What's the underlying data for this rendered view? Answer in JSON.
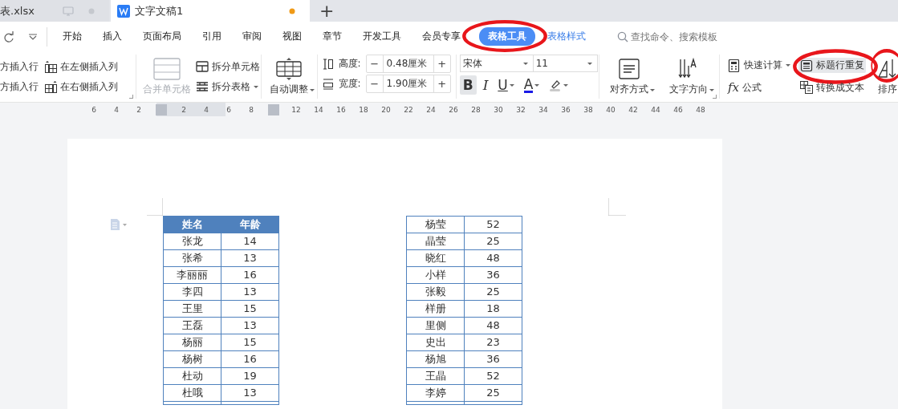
{
  "tabs": [
    {
      "title": "表.xlsx",
      "kind": "sheet",
      "selected": false,
      "modified": false
    },
    {
      "title": "文字文稿1",
      "kind": "doc",
      "selected": true,
      "modified": true
    }
  ],
  "new_tab": "+",
  "menu": [
    {
      "label": "开始",
      "selected": false,
      "circled": false
    },
    {
      "label": "插入",
      "selected": false,
      "circled": false
    },
    {
      "label": "页面布局",
      "selected": false,
      "circled": false
    },
    {
      "label": "引用",
      "selected": false,
      "circled": false
    },
    {
      "label": "审阅",
      "selected": false,
      "circled": false
    },
    {
      "label": "视图",
      "selected": false,
      "circled": false
    },
    {
      "label": "章节",
      "selected": false,
      "circled": false
    },
    {
      "label": "开发工具",
      "selected": false,
      "circled": false
    },
    {
      "label": "会员专享",
      "selected": false,
      "circled": false
    },
    {
      "label": "表格工具",
      "selected": true,
      "circled": true
    },
    {
      "label": "表格样式",
      "selected": false,
      "circled": false
    }
  ],
  "search": {
    "placeholder": "查找命令、搜索模板"
  },
  "ribbon": {
    "insert": [
      {
        "label": "方插入行",
        "kind": "row"
      },
      {
        "label": "在左侧插入列",
        "kind": "col-left"
      },
      {
        "label": "方插入行",
        "kind": "row"
      },
      {
        "label": "在右侧插入列",
        "kind": "col-right"
      }
    ],
    "merge": {
      "label": "合并单元格",
      "disabled": true
    },
    "split_cell": "拆分单元格",
    "split_table": "拆分表格",
    "auto_fit": "自动调整",
    "sizes": [
      {
        "kind": "height",
        "label": "高度:",
        "value": "0.48厘米",
        "minus": "−",
        "plus": "+"
      },
      {
        "kind": "width",
        "label": "宽度:",
        "value": "1.90厘米",
        "minus": "−",
        "plus": "+"
      }
    ],
    "font": {
      "value": "宋体"
    },
    "font_size": {
      "value": "11"
    },
    "format": [
      {
        "kind": "bold",
        "label": "B",
        "on": true
      },
      {
        "kind": "italic",
        "label": "I",
        "on": false
      },
      {
        "kind": "underline",
        "label": "U",
        "on": false
      },
      {
        "kind": "color",
        "label": "A",
        "on": false
      },
      {
        "kind": "highlight",
        "on": false
      }
    ],
    "align": "对齐方式",
    "direction": "文字方向",
    "tools": [
      {
        "label": "快速计算",
        "kind": "calc",
        "circled": false,
        "on": false
      },
      {
        "label": "标题行重复",
        "kind": "repeat",
        "circled": true,
        "on": true
      },
      {
        "label": "公式",
        "kind": "fx",
        "icon_text": "fx",
        "circled": false,
        "on": false
      },
      {
        "label": "转换成文本",
        "kind": "convert",
        "circled": false,
        "on": false
      }
    ],
    "sort": {
      "label": "排序",
      "circled": true
    }
  },
  "ruler": [
    {
      "label": "6"
    },
    {
      "label": "4"
    },
    {
      "label": "2"
    },
    {
      "kind": "marker"
    },
    {
      "label": "2"
    },
    {
      "label": "4"
    },
    {
      "label": "6"
    },
    {
      "label": "8"
    },
    {
      "kind": "marker"
    },
    {
      "label": "12"
    },
    {
      "label": "14"
    },
    {
      "label": "16"
    },
    {
      "label": "18"
    },
    {
      "label": "20"
    },
    {
      "label": "22"
    },
    {
      "label": "24"
    },
    {
      "label": "26"
    },
    {
      "label": "28"
    },
    {
      "label": "30"
    },
    {
      "label": "32"
    },
    {
      "label": "34"
    },
    {
      "label": "36"
    },
    {
      "label": "38"
    },
    {
      "label": "40"
    },
    {
      "label": "42"
    },
    {
      "label": "44"
    },
    {
      "label": "46"
    },
    {
      "label": "48"
    }
  ],
  "tables": [
    {
      "header": [
        "姓名",
        "年龄"
      ],
      "rows": [
        [
          "张龙",
          "14"
        ],
        [
          "张希",
          "13"
        ],
        [
          "李丽丽",
          "16"
        ],
        [
          "李四",
          "13"
        ],
        [
          "王里",
          "15"
        ],
        [
          "王磊",
          "13"
        ],
        [
          "杨丽",
          "15"
        ],
        [
          "杨树",
          "16"
        ],
        [
          "杜动",
          "19"
        ],
        [
          "杜哦",
          "13"
        ]
      ]
    },
    {
      "rows": [
        [
          "杨莹",
          "52"
        ],
        [
          "晶莹",
          "25"
        ],
        [
          "晓红",
          "48"
        ],
        [
          "小样",
          "36"
        ],
        [
          "张毅",
          "25"
        ],
        [
          "样册",
          "18"
        ],
        [
          "里侧",
          "48"
        ],
        [
          "史出",
          "23"
        ],
        [
          "杨旭",
          "36"
        ],
        [
          "王晶",
          "52"
        ],
        [
          "李婷",
          "25"
        ]
      ]
    }
  ]
}
